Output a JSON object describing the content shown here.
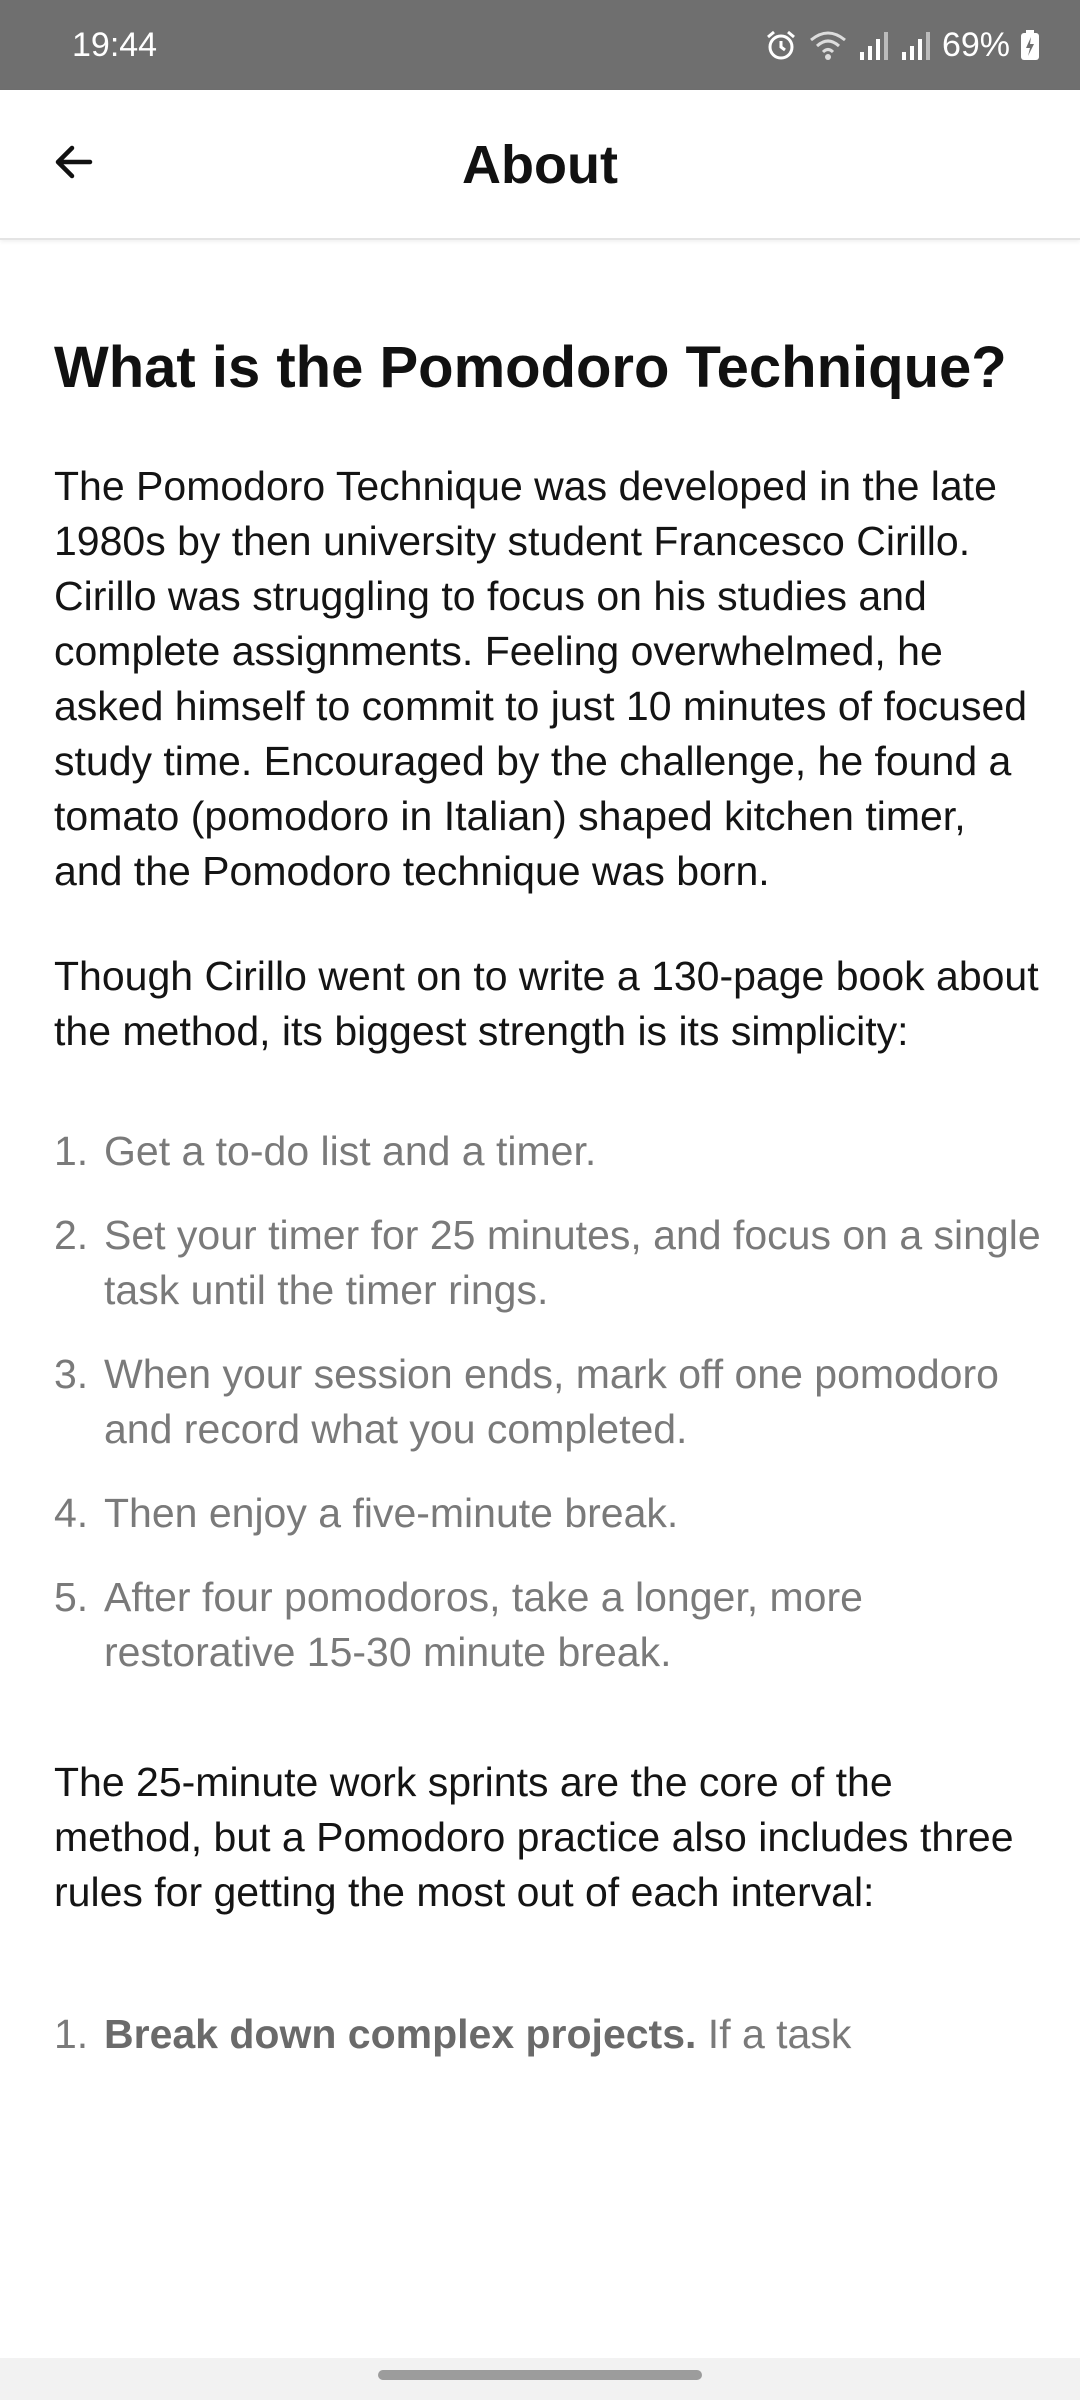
{
  "status_bar": {
    "time": "19:44",
    "battery": "69%",
    "icons": [
      "alarm-icon",
      "wifi-icon",
      "signal-icon",
      "signal-icon-2",
      "battery-charging-icon"
    ]
  },
  "app_bar": {
    "title": "About",
    "back_icon": "arrow-left-icon"
  },
  "content": {
    "heading": "What is the Pomodoro Technique?",
    "paragraph1": "The Pomodoro Technique was developed in the late 1980s by then university student Francesco Cirillo. Cirillo was struggling to focus on his studies and complete assignments. Feeling overwhelmed, he asked himself to commit to just 10 minutes of focused study time. Encouraged by the challenge, he found a tomato (pomodoro in Italian) shaped kitchen timer, and the Pomodoro technique was born.",
    "paragraph2": "Though Cirillo went on to write a 130-page book about the method, its biggest strength is its simplicity:",
    "steps": [
      {
        "num": "1.",
        "text": "Get a to-do list and a timer."
      },
      {
        "num": "2.",
        "text": "Set your timer for 25 minutes, and focus on a single task until the timer rings."
      },
      {
        "num": "3.",
        "text": "When your session ends, mark off one pomodoro and record what you completed."
      },
      {
        "num": "4.",
        "text": "Then enjoy a five-minute break."
      },
      {
        "num": "5.",
        "text": "After four pomodoros, take a longer, more restorative 15-30 minute break."
      }
    ],
    "paragraph3": "The 25-minute work sprints are the core of the method, but a Pomodoro practice also includes three rules for getting the most out of each interval:",
    "rules": [
      {
        "num": "1.",
        "bold": "Break down complex projects.",
        "text": " If a task"
      }
    ]
  },
  "colors": {
    "status_bar_bg": "#6f6f6f",
    "list_text": "#7a7a7a",
    "body_text": "#141414"
  }
}
